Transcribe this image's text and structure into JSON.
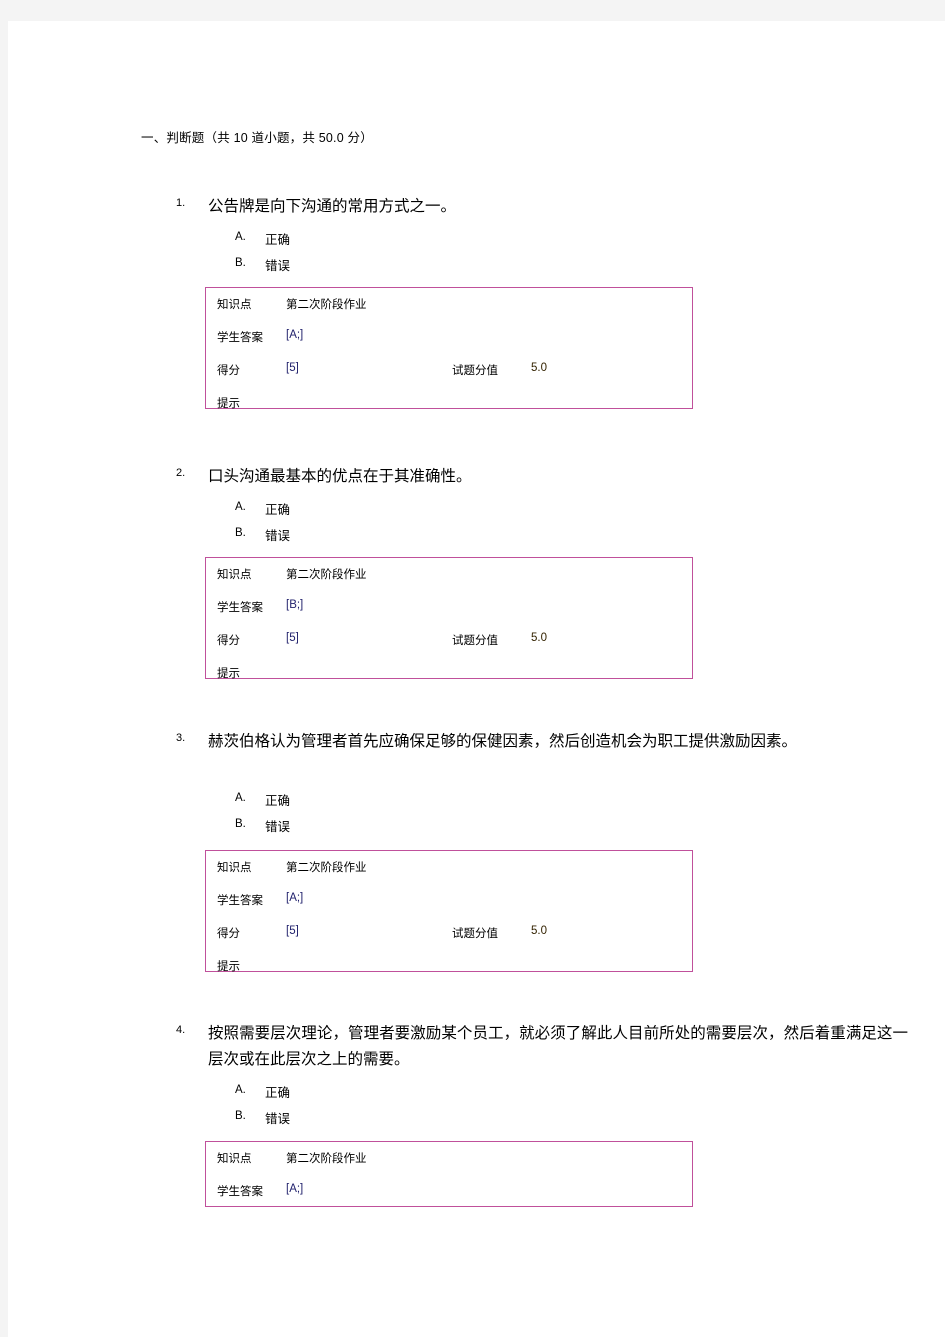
{
  "document": {
    "section_title": "一、判断题（共 10 道小题，共 50.0 分）",
    "labels": {
      "knowledge_point": "知识点",
      "student_answer": "学生答案",
      "score": "得分",
      "question_value": "试题分值",
      "hint": "提示"
    },
    "accent_color": "#c0509b",
    "questions": [
      {
        "number": "1.",
        "text": "公告牌是向下沟通的常用方式之一。",
        "options": [
          {
            "letter": "A.",
            "text": "正确"
          },
          {
            "letter": "B.",
            "text": "错误"
          }
        ],
        "result": {
          "knowledge_point_value": "第二次阶段作业",
          "student_answer_value": "[A;]",
          "score_value": "[5]",
          "question_value_value": "5.0",
          "hint_value": ""
        }
      },
      {
        "number": "2.",
        "text": "口头沟通最基本的优点在于其准确性。",
        "options": [
          {
            "letter": "A.",
            "text": "正确"
          },
          {
            "letter": "B.",
            "text": "错误"
          }
        ],
        "result": {
          "knowledge_point_value": "第二次阶段作业",
          "student_answer_value": "[B;]",
          "score_value": "[5]",
          "question_value_value": "5.0",
          "hint_value": ""
        }
      },
      {
        "number": "3.",
        "text": "赫茨伯格认为管理者首先应确保足够的保健因素，然后创造机会为职工提供激励因素。",
        "options": [
          {
            "letter": "A.",
            "text": "正确"
          },
          {
            "letter": "B.",
            "text": "错误"
          }
        ],
        "result": {
          "knowledge_point_value": "第二次阶段作业",
          "student_answer_value": "[A;]",
          "score_value": "[5]",
          "question_value_value": "5.0",
          "hint_value": ""
        }
      },
      {
        "number": "4.",
        "text": "按照需要层次理论，管理者要激励某个员工，就必须了解此人目前所处的需要层次，然后着重满足这一层次或在此层次之上的需要。",
        "options": [
          {
            "letter": "A.",
            "text": "正确"
          },
          {
            "letter": "B.",
            "text": "错误"
          }
        ],
        "result": {
          "knowledge_point_value": "第二次阶段作业",
          "student_answer_value": "[A;]",
          "score_value": "",
          "question_value_value": "",
          "hint_value": ""
        }
      }
    ]
  }
}
